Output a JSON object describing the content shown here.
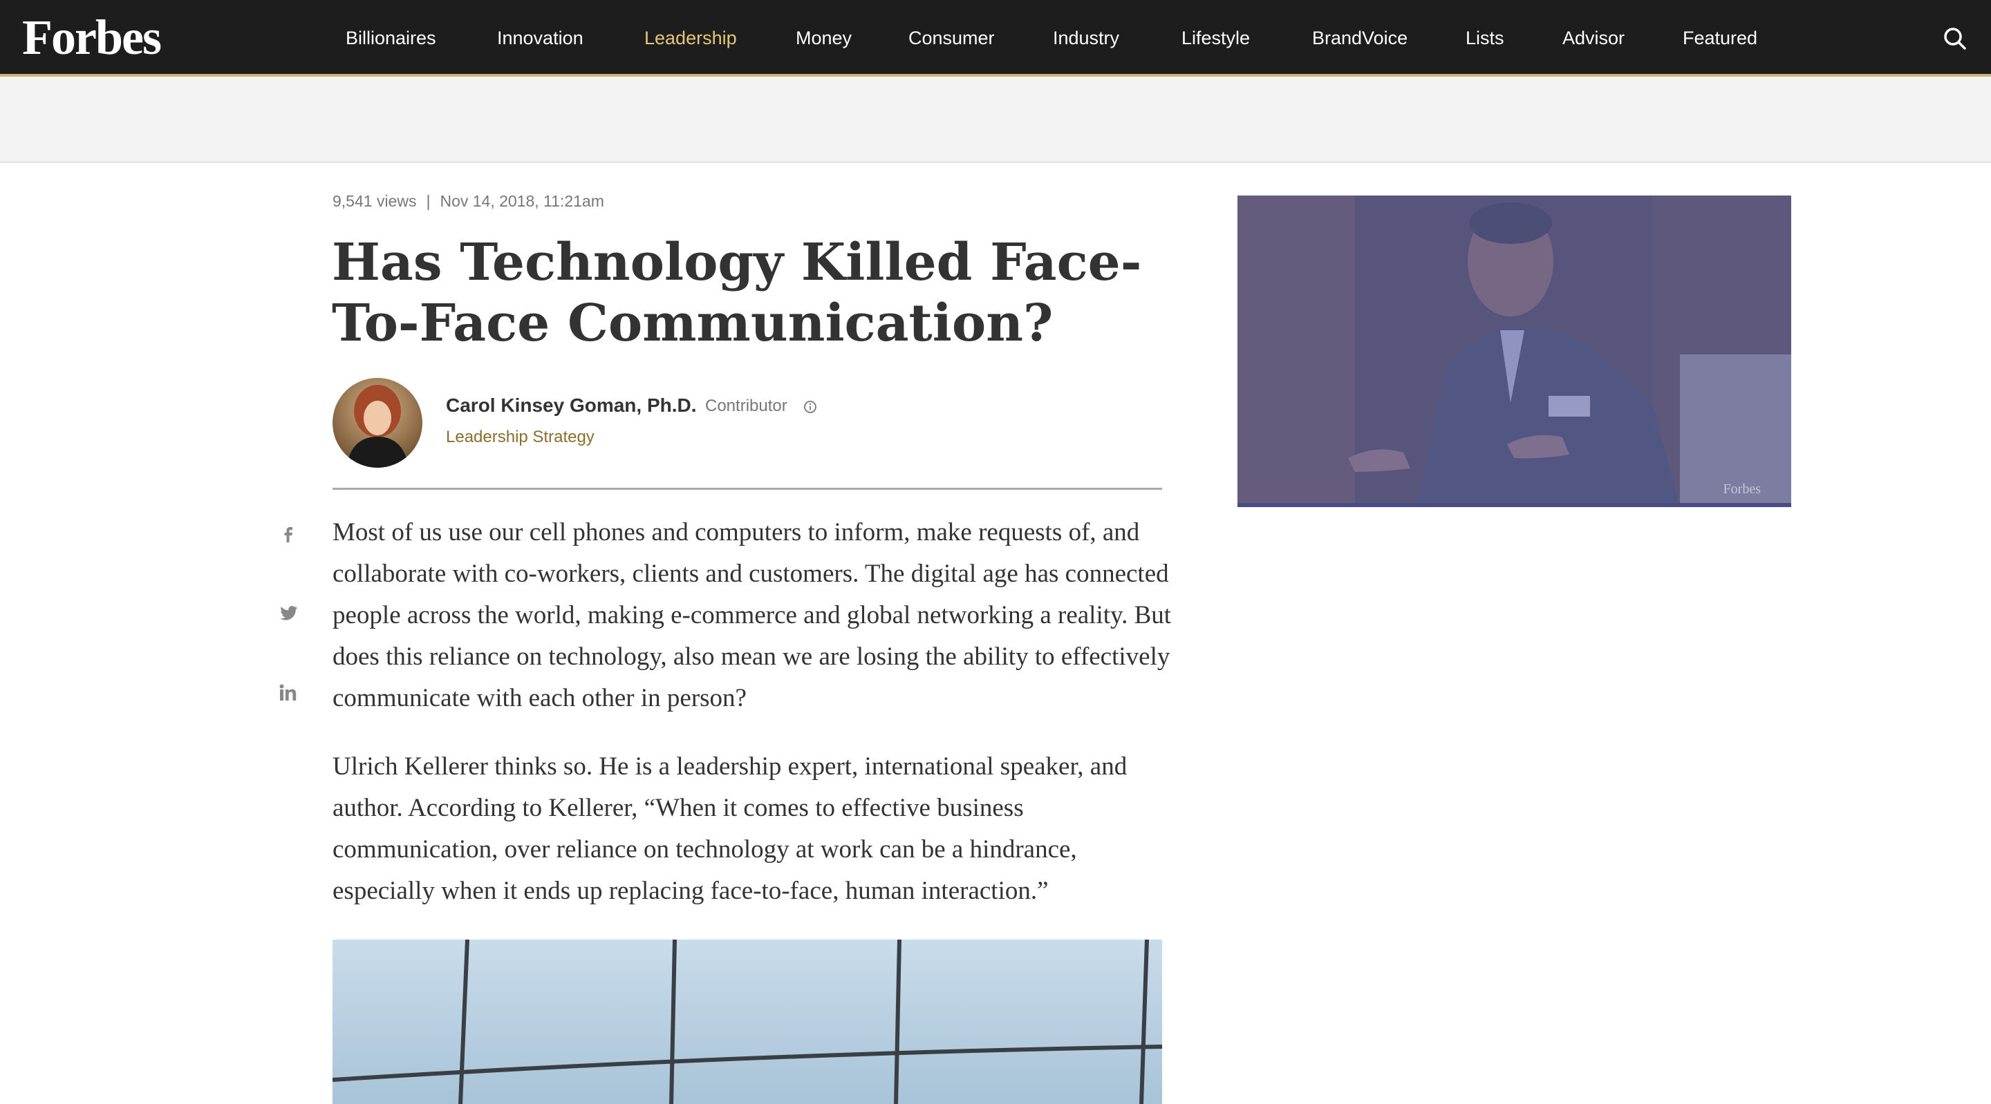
{
  "brand": {
    "logo": "Forbes",
    "accent": "#c8b574",
    "nav_bg": "#1d1d1d",
    "active_color": "#e6c77a"
  },
  "nav": {
    "items": [
      {
        "label": "Billionaires"
      },
      {
        "label": "Innovation"
      },
      {
        "label": "Leadership",
        "active": true
      },
      {
        "label": "Money"
      },
      {
        "label": "Consumer"
      },
      {
        "label": "Industry"
      },
      {
        "label": "Lifestyle"
      },
      {
        "label": "BrandVoice"
      },
      {
        "label": "Lists"
      },
      {
        "label": "Advisor"
      },
      {
        "label": "Featured"
      }
    ],
    "search_icon": "search-icon"
  },
  "article": {
    "views": "9,541 views",
    "separator": "|",
    "date": "Nov 14, 2018, 11:21am",
    "title": "Has Technology Killed Face-To-Face Communication?",
    "author": {
      "name": "Carol Kinsey Goman, Ph.D.",
      "role": "Contributor",
      "channel": "Leadership Strategy"
    },
    "social": [
      "facebook-icon",
      "twitter-icon",
      "linkedin-icon"
    ],
    "paragraphs": [
      "Most of us use our cell phones and computers to inform, make requests of, and collaborate with co-workers, clients and customers. The digital age has connected people across the world, making e-commerce and global networking a reality. But does this reliance on technology, also mean we are losing the ability to effectively communicate with each other in person?",
      "Ulrich Kellerer thinks so. He is a leadership expert, international speaker, and author. According to Kellerer, “When it comes to effective business communication, over reliance on technology at work can be a hindrance, especially when it ends up replacing face-to-face, human interaction.”"
    ]
  },
  "video": {
    "watermark": "Forbes",
    "overlay_color": "#6b6fb0"
  }
}
